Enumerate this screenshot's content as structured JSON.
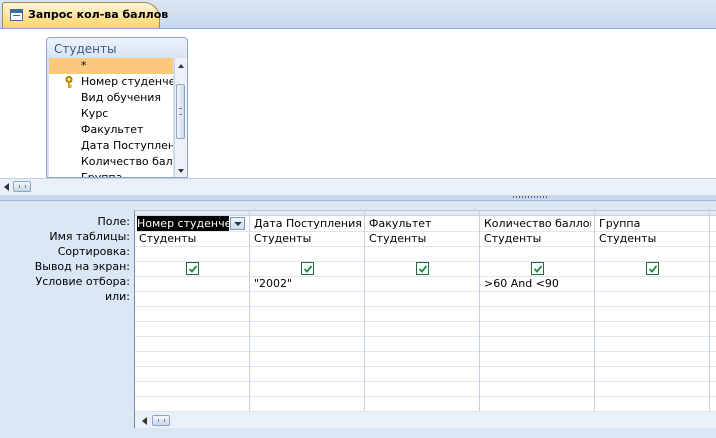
{
  "tab": {
    "title": "Запрос кол-ва баллов",
    "icon": "query-icon"
  },
  "table_box": {
    "title": "Студенты",
    "fields": [
      {
        "label": "*",
        "selected": true,
        "key": false
      },
      {
        "label": "Номер студенческого",
        "selected": false,
        "key": true
      },
      {
        "label": "Вид обучения",
        "selected": false,
        "key": false
      },
      {
        "label": "Курс",
        "selected": false,
        "key": false
      },
      {
        "label": "Факультет",
        "selected": false,
        "key": false
      },
      {
        "label": "Дата Поступления",
        "selected": false,
        "key": false
      },
      {
        "label": "Количество баллов",
        "selected": false,
        "key": false
      },
      {
        "label": "Группа",
        "selected": false,
        "key": false
      }
    ]
  },
  "grid": {
    "row_labels": [
      "Поле:",
      "Имя таблицы:",
      "Сортировка:",
      "Вывод на экран:",
      "Условие отбора:",
      "или:"
    ],
    "columns": [
      {
        "field": "Номер студенческого",
        "table": "Студенты",
        "sort": "",
        "show": true,
        "criteria": "",
        "or": "",
        "active": true
      },
      {
        "field": "Дата Поступления",
        "table": "Студенты",
        "sort": "",
        "show": true,
        "criteria": "\"2002\"",
        "or": "",
        "active": false
      },
      {
        "field": "Факультет",
        "table": "Студенты",
        "sort": "",
        "show": true,
        "criteria": "",
        "or": "",
        "active": false
      },
      {
        "field": "Количество баллов",
        "table": "Студенты",
        "sort": "",
        "show": true,
        "criteria": ">60 And <90",
        "or": "",
        "active": false
      },
      {
        "field": "Группа",
        "table": "Студенты",
        "sort": "",
        "show": true,
        "criteria": "",
        "or": "",
        "active": false
      },
      {
        "field": "",
        "table": "",
        "sort": "",
        "show": false,
        "criteria": "",
        "or": "",
        "active": false
      }
    ]
  },
  "colors": {
    "selection": "#fbc87d",
    "pane_bg": "#dce7f5",
    "tab_bg": "#ffe39a",
    "check": "#1f8a3e"
  }
}
